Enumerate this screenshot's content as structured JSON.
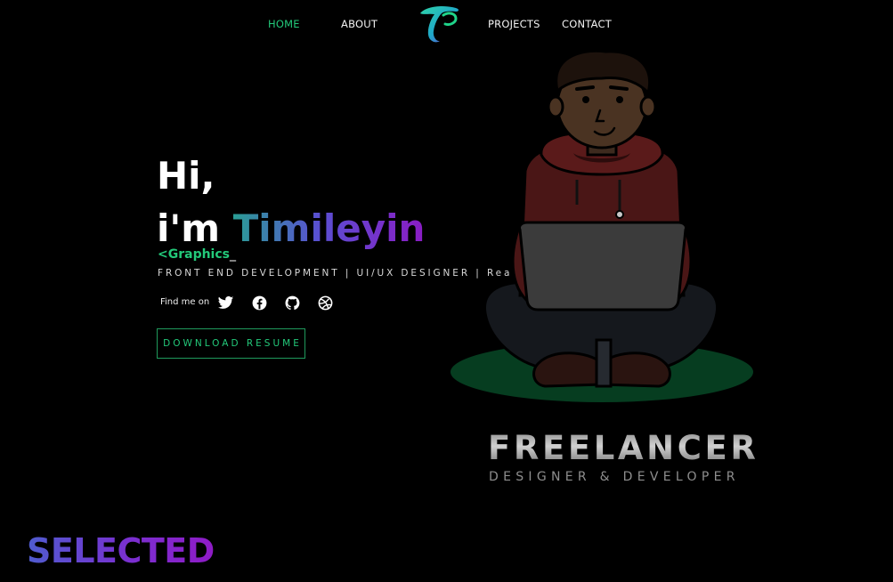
{
  "nav": {
    "home": "HOME",
    "about": "ABOUT",
    "projects": "PROJECTS",
    "contact": "CONTACT",
    "active": "home"
  },
  "hero": {
    "greeting": "Hi,",
    "intro": "i'm ",
    "name": "Timileyin",
    "typing_text": "<Graphics",
    "typing_cursor": "_",
    "roles": "FRONT END DEVELOPMENT | UI/UX DESIGNER | ReactJS",
    "find_me": "Find me on",
    "resume_button": "DOWNLOAD RESUME"
  },
  "social": [
    "twitter-icon",
    "facebook-icon",
    "github-icon",
    "dribbble-icon"
  ],
  "badge": {
    "title": "FREELANCER",
    "subtitle": "DESIGNER & DEVELOPER"
  },
  "section": {
    "heading": "SELECTED"
  },
  "colors": {
    "background": "#000000",
    "accent_green": "#23c97a",
    "gradient_start": "#2a9d95",
    "gradient_end": "#8a1cc4"
  }
}
